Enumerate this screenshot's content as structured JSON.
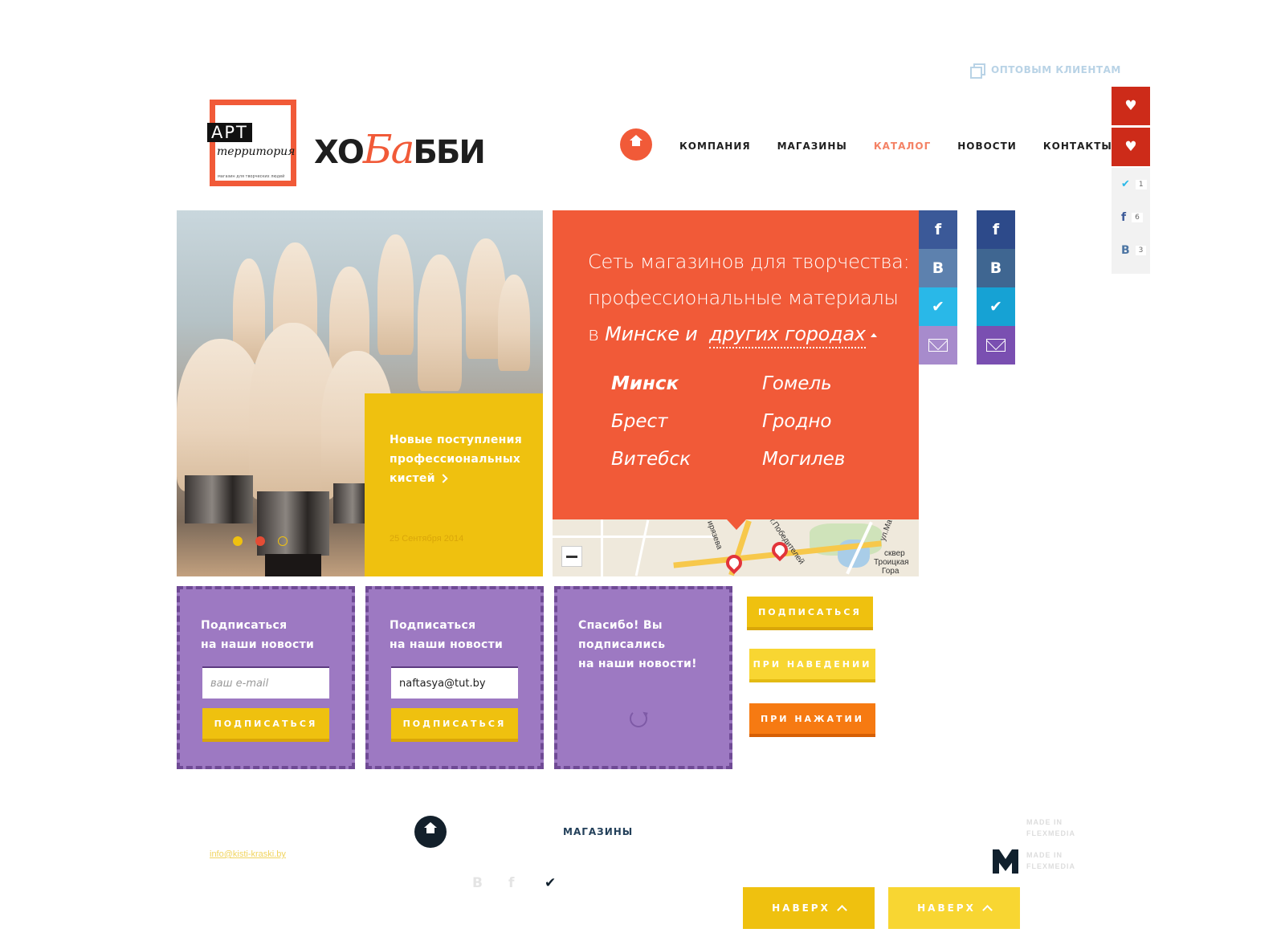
{
  "header": {
    "wholesale_link": "ОПТОВЫМ КЛИЕНТАМ",
    "logo_art_word": "АРТ",
    "logo_art_script": "территория",
    "logo_art_tagline": "магазин для творческих людей",
    "logo_hobby": {
      "left": "ХО",
      "mid": "Ба",
      "right": "ББИ"
    }
  },
  "nav": {
    "items": [
      {
        "label": "КОМПАНИЯ"
      },
      {
        "label": "МАГАЗИНЫ"
      },
      {
        "label": "КАТАЛОГ",
        "active": true
      },
      {
        "label": "НОВОСТИ"
      },
      {
        "label": "КОНТАКТЫ"
      }
    ]
  },
  "sidebar": {
    "counts": [
      {
        "icon": "twitter-icon",
        "symbol": "🐦",
        "count": "1"
      },
      {
        "icon": "facebook-icon",
        "symbol": "f",
        "count": "6"
      },
      {
        "icon": "vk-icon",
        "symbol": "В",
        "count": "3"
      }
    ]
  },
  "slider": {
    "news_title": "Новые поступления профессиональных кистей",
    "news_date": "25 Сентября 2014"
  },
  "promo": {
    "line1": "Сеть магазинов для творчества:",
    "line2": "профессиональные материалы",
    "line3_prefix": "в ",
    "line3_city": "Минске и",
    "line3_other": "других городах",
    "cities": [
      "Минск",
      "Гомель",
      "Брест",
      "Гродно",
      "Витебск",
      "Могилев"
    ]
  },
  "map": {
    "labels": [
      "ирязева",
      "г.Победителей",
      "ул.Ма",
      "сквер",
      "Троицкая",
      "Гора"
    ]
  },
  "social": {
    "fb": "f",
    "vk": "В"
  },
  "subscribe": {
    "line1": "Подписаться",
    "line2": "на наши новости",
    "placeholder": "ваш e-mail",
    "filled_value": "naftasya@tut.by",
    "button": "ПОДПИСАТЬСЯ",
    "thanks_line1": "Спасибо! Вы",
    "thanks_line2": "подписались",
    "thanks_line3": "на наши новости!"
  },
  "button_states": {
    "normal": "ПОДПИСАТЬСЯ",
    "hover": "ПРИ НАВЕДЕНИИ",
    "pressed": "ПРИ НАЖАТИИ"
  },
  "footer": {
    "shops": "МАГАЗИНЫ",
    "email": "info@kisti-kraski.by",
    "made_in_1": "MADE IN",
    "made_in_2": "FLEXMEDIA",
    "up": "НАВЕРХ"
  },
  "colors": {
    "orange": "#f15a38",
    "yellow": "#efc10f",
    "purple": "#9d79c2",
    "facebook": "#3b5998",
    "vk": "#4c75a3",
    "twitter": "#29b8e8",
    "mail": "#9d79c2"
  }
}
